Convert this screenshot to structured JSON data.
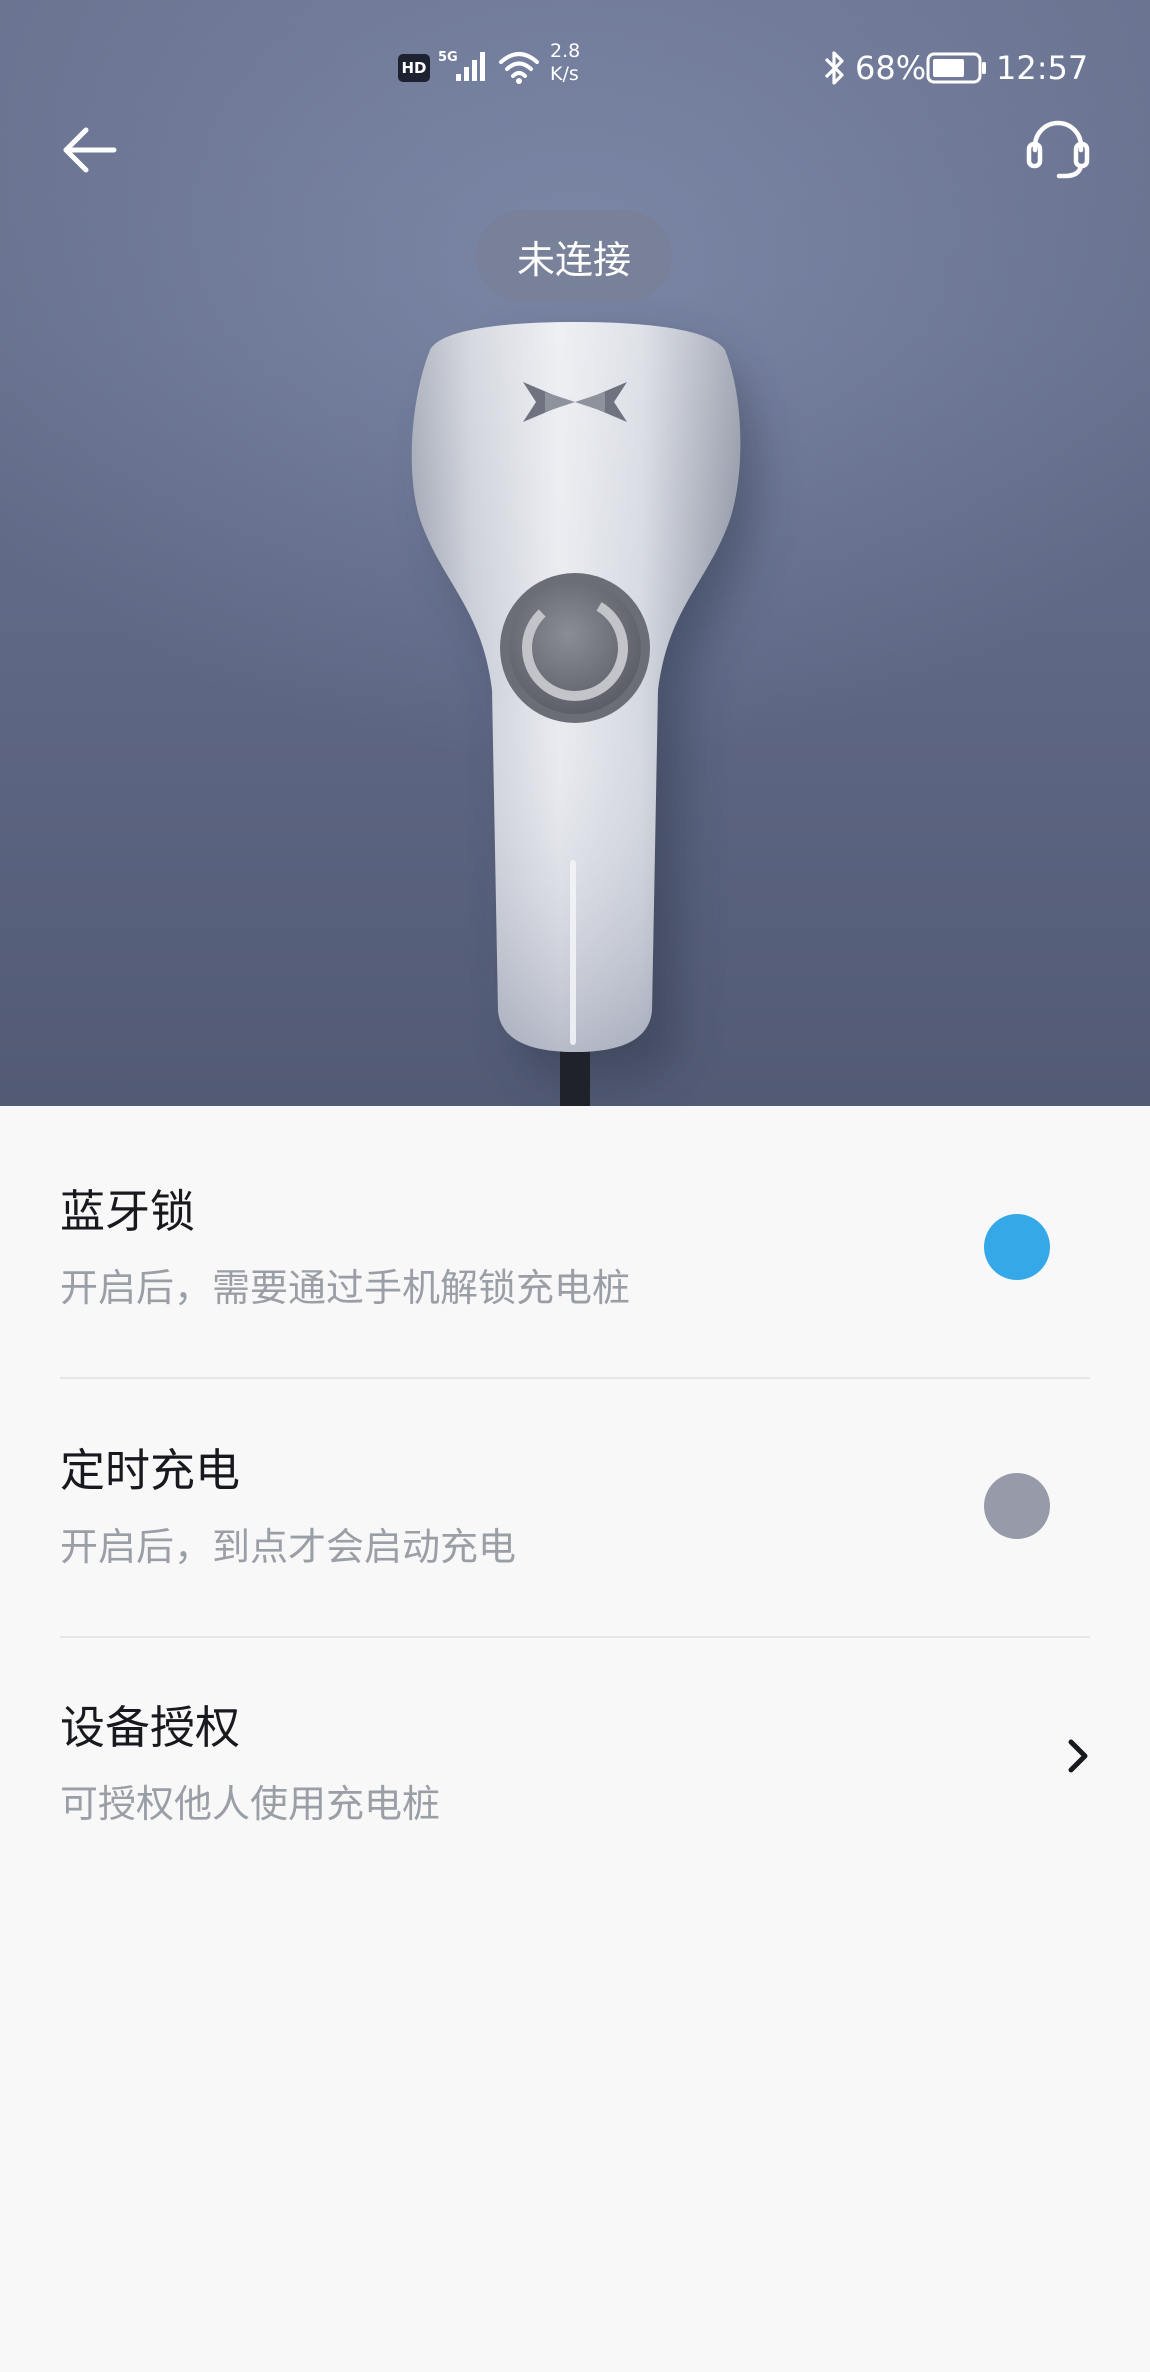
{
  "status_bar": {
    "hd_badge": "HD",
    "network_type": "5G",
    "net_speed_value": "2.8",
    "net_speed_unit": "K/s",
    "battery_percent": "68%",
    "time": "12:57"
  },
  "header": {
    "back_icon": "arrow-left-icon",
    "service_icon": "headset-icon"
  },
  "device": {
    "connection_status": "未连接",
    "logo": "xpeng-x-logo",
    "loading_icon": "spinner-icon"
  },
  "settings": {
    "items": [
      {
        "title": "蓝牙锁",
        "description": "开启后，需要通过手机解锁充电桩",
        "control": "toggle",
        "state": "on",
        "color": "#35a9e8"
      },
      {
        "title": "定时充电",
        "description": "开启后，到点才会启动充电",
        "control": "toggle",
        "state": "off",
        "color": "#979ba9"
      },
      {
        "title": "设备授权",
        "description": "可授权他人使用充电桩",
        "control": "chevron-right-icon"
      }
    ]
  },
  "colors": {
    "accent": "#35a9e8",
    "toggle_off": "#979ba9",
    "hero_bg": "#646d8a",
    "background": "#f8f8f8"
  }
}
